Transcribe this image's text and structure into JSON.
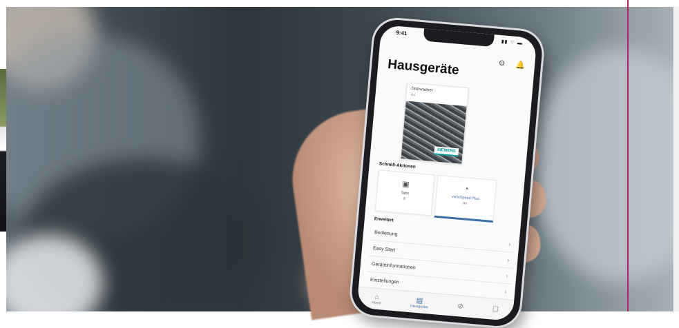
{
  "app": {
    "status_time": "9:41",
    "status_icons": "▮▮ ⌔ ▬",
    "title": "Hausgeräte",
    "header_icons": {
      "settings_glyph": "⚙",
      "bell_glyph": "🔔"
    }
  },
  "appliance": {
    "name": "Dishwasher",
    "status": "On",
    "brand": "SIEMENS"
  },
  "quick_actions": {
    "heading": "Schnell-Aktionen",
    "items": [
      {
        "label": "Tabs",
        "sub": "8",
        "glyph": "▣"
      },
      {
        "label": "varioSpeed Plus",
        "sub": "an",
        "glyph": "◔"
      }
    ]
  },
  "extended": {
    "heading": "Erweitert",
    "items": [
      "Bedienung",
      "Easy Start",
      "Geräteinformationen",
      "Einstellungen"
    ]
  },
  "tabbar": [
    {
      "label": "Home",
      "glyph": "⌂"
    },
    {
      "label": "Hausgeräte",
      "glyph": "▤"
    },
    {
      "label": "",
      "glyph": "⊘"
    },
    {
      "label": "",
      "glyph": "☐"
    }
  ],
  "colors": {
    "accent_blue": "#3c6ea8",
    "brand_teal": "#009999",
    "frame_line": "#b11f6b"
  }
}
